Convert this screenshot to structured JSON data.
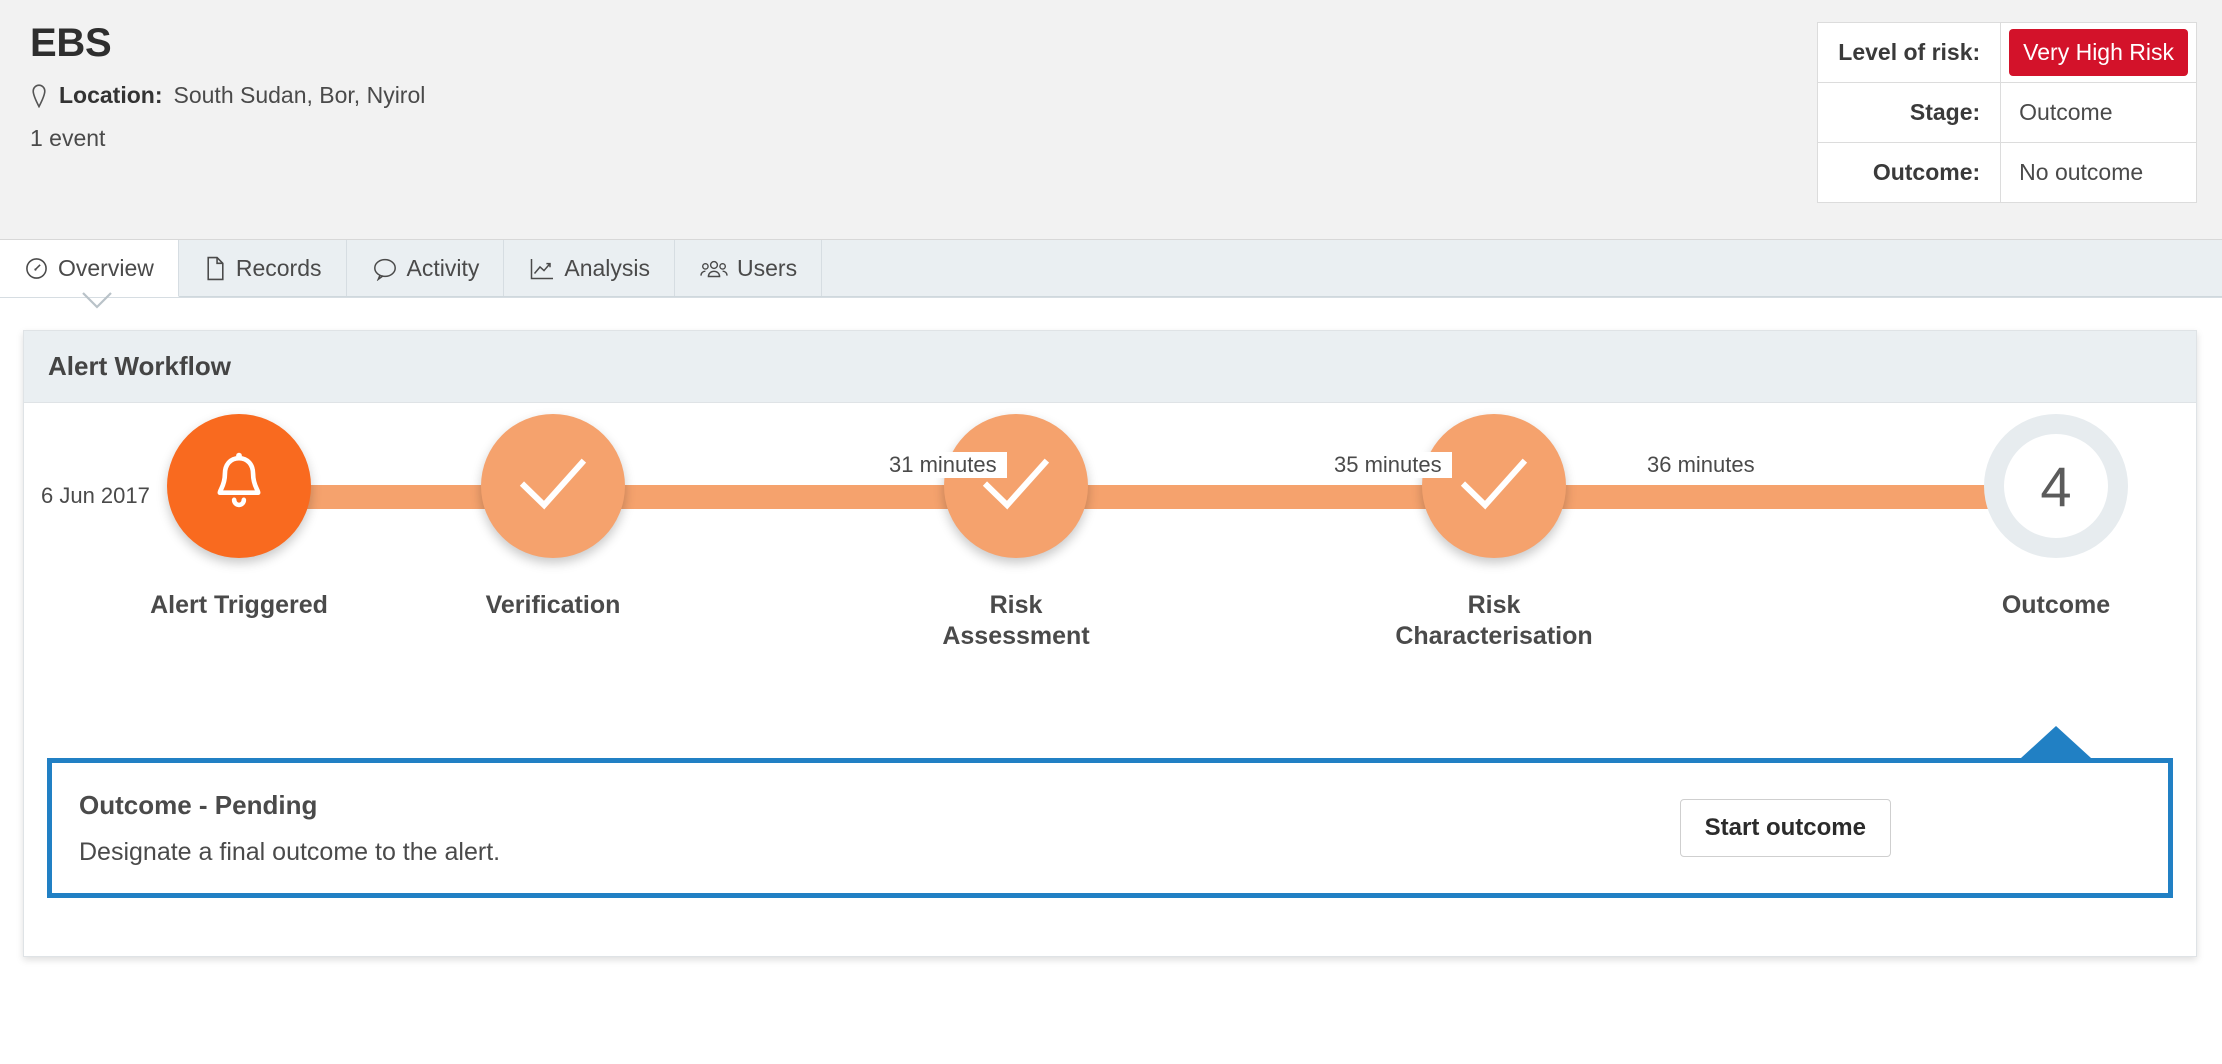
{
  "header": {
    "title": "EBS",
    "location_icon": "map-pin-icon",
    "location_label": "Location:",
    "location_value": "South Sudan, Bor, Nyirol",
    "event_count": "1 event",
    "risk_table": [
      {
        "key": "Level of risk:",
        "value": "Very High Risk",
        "badge": true,
        "color": "#d3122a"
      },
      {
        "key": "Stage:",
        "value": "Outcome",
        "badge": false
      },
      {
        "key": "Outcome:",
        "value": "No outcome",
        "badge": false
      }
    ]
  },
  "tabs": [
    {
      "label": "Overview",
      "icon": "gauge-icon",
      "active": true
    },
    {
      "label": "Records",
      "icon": "file-icon",
      "active": false
    },
    {
      "label": "Activity",
      "icon": "speech-bubble-icon",
      "active": false
    },
    {
      "label": "Analysis",
      "icon": "line-chart-icon",
      "active": false
    },
    {
      "label": "Users",
      "icon": "people-icon",
      "active": false
    }
  ],
  "card": {
    "title": "Alert Workflow"
  },
  "workflow": {
    "start_date": "6 Jun 2017",
    "nodes": [
      {
        "label": "Alert Triggered",
        "state": "primary",
        "icon": "bell-icon"
      },
      {
        "label": "Verification",
        "state": "done",
        "icon": "check-icon"
      },
      {
        "label": "Risk\nAssessment",
        "state": "done",
        "icon": "check-icon"
      },
      {
        "label": "Risk\nCharacterisation",
        "state": "done",
        "icon": "check-icon"
      },
      {
        "label": "Outcome",
        "state": "pending",
        "icon": "step-number",
        "number": "4"
      }
    ],
    "durations": [
      "",
      "31 minutes",
      "35 minutes",
      "36 minutes"
    ],
    "colors": {
      "primary": "#f96a1f",
      "done": "#f5a26d",
      "pending_ring": "#e7ecef",
      "track": "#f5a26d"
    }
  },
  "outcome_panel": {
    "title": "Outcome - Pending",
    "description": "Designate a final outcome to the alert.",
    "button_label": "Start outcome",
    "accent_color": "#2180c4"
  }
}
